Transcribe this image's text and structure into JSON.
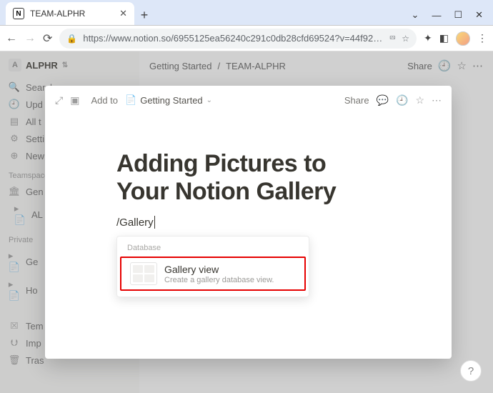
{
  "browser": {
    "tab_title": "TEAM-ALPHR",
    "url": "https://www.notion.so/6955125ea56240c291c0db28cfd69524?v=44f92629c3..."
  },
  "sidebar": {
    "workspace": "ALPHR",
    "items": [
      {
        "icon": "🔍",
        "label": "Search"
      },
      {
        "icon": "🕘",
        "label": "Upd"
      },
      {
        "icon": "▤",
        "label": "All t"
      },
      {
        "icon": "⚙",
        "label": "Setti"
      },
      {
        "icon": "⊕",
        "label": "New"
      }
    ],
    "section1": "Teamspace",
    "teamspace": [
      {
        "icon": "🏛",
        "label": "Gen"
      },
      {
        "icon": "▸ 📄",
        "label": "AL"
      }
    ],
    "section2": "Private",
    "private_items": [
      {
        "icon": "▸ 📄",
        "label": "Ge"
      },
      {
        "icon": "▸ 📄",
        "label": "Ho"
      }
    ],
    "footer": [
      {
        "icon": "�! ",
        "label": "Tem"
      },
      {
        "icon": "⮋",
        "label": "Imp"
      },
      {
        "icon": "🗑",
        "label": "Tras"
      }
    ]
  },
  "header": {
    "crumb1": "Getting Started",
    "sep": "/",
    "crumb2": "TEAM-ALPHR",
    "share": "Share"
  },
  "modal": {
    "add_to": "Add to",
    "page_icon": "📄",
    "page_crumb": "Getting Started",
    "share": "Share",
    "title": "Adding Pictures to Your Notion Gallery",
    "slash_input": "/Gallery"
  },
  "slash_menu": {
    "category": "Database",
    "item": {
      "title": "Gallery view",
      "desc": "Create a gallery database view."
    }
  },
  "help": "?"
}
